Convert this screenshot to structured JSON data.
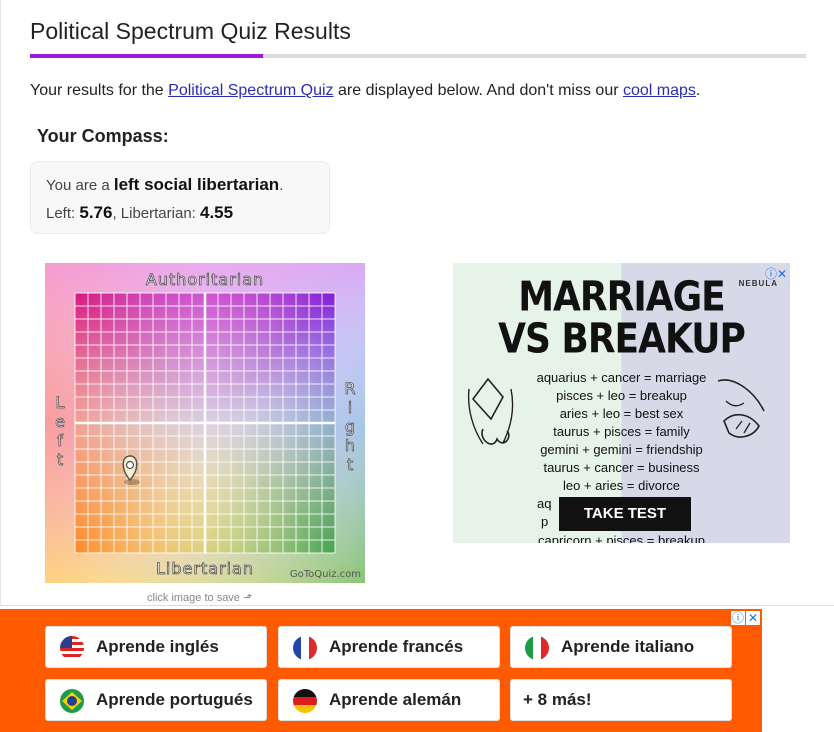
{
  "header": {
    "title": "Political Spectrum Quiz Results"
  },
  "intro": {
    "prefix": "Your results for the ",
    "quiz_link": "Political Spectrum Quiz",
    "middle": " are displayed below. And don't miss our ",
    "maps_link": "cool maps",
    "suffix": "."
  },
  "compass": {
    "heading": "Your Compass:",
    "result_prefix": "You are a ",
    "result_value": "left social libertarian",
    "result_suffix": ".",
    "left_label": "Left: ",
    "left_value": "5.76",
    "lib_label": ", Libertarian: ",
    "lib_value": "4.55",
    "chart": {
      "top_label": "Authoritarian",
      "bottom_label": "Libertarian",
      "left_label": "Left",
      "right_label": "Right",
      "watermark": "GoToQuiz.com"
    },
    "click_hint": "click image to save ⬏"
  },
  "ad_right": {
    "brand": "NEBULA",
    "headline_1": "MARRIAGE",
    "headline_2": "VS BREAKUP",
    "lines": [
      "aquarius + cancer = marriage",
      "pisces + leo = breakup",
      "aries + leo = best sex",
      "taurus + pisces = family",
      "gemini + gemini = friendship",
      "taurus + cancer = business",
      "leo + aries = divorce",
      "aq",
      "p"
    ],
    "cta": "TAKE TEST",
    "cut_line": "capricorn + pisces = breakup"
  },
  "ad_bottom": {
    "buttons": [
      {
        "label": "Aprende inglés",
        "flag": "us-flag-icon"
      },
      {
        "label": "Aprende francés",
        "flag": "france-flag-icon"
      },
      {
        "label": "Aprende italiano",
        "flag": "italy-flag-icon"
      },
      {
        "label": "Aprende portugués",
        "flag": "brazil-flag-icon"
      },
      {
        "label": "Aprende alemán",
        "flag": "germany-flag-icon"
      },
      {
        "label": "+ 8 más!",
        "flag": ""
      }
    ]
  },
  "colors": {
    "accent": "#9b19d8",
    "link": "#2a2fb0",
    "ad_orange": "#ff5a00"
  }
}
